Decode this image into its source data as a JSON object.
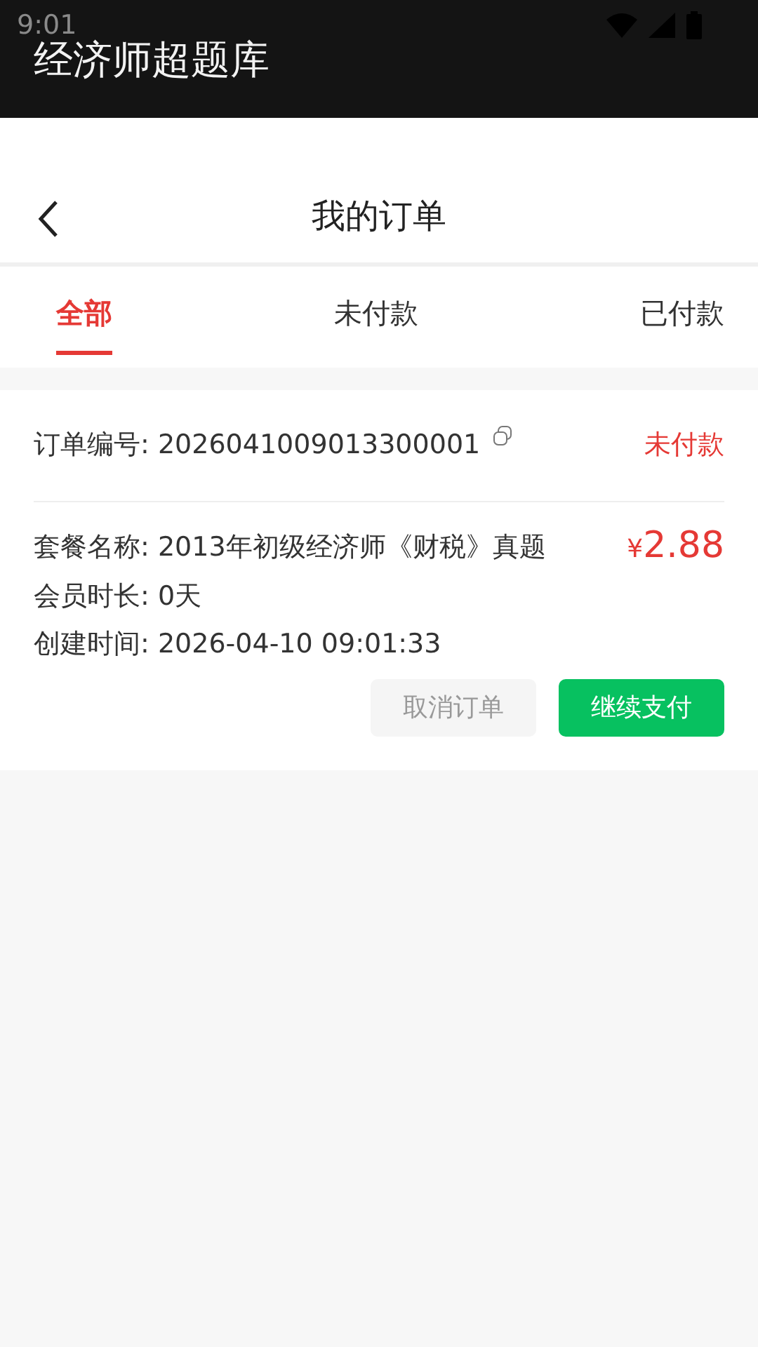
{
  "status_bar": {
    "time": "9:01"
  },
  "app_bar": {
    "title": "经济师超题库"
  },
  "header": {
    "title": "我的订单"
  },
  "tabs": [
    {
      "label": "全部",
      "selected": true
    },
    {
      "label": "未付款",
      "selected": false
    },
    {
      "label": "已付款",
      "selected": false
    }
  ],
  "orders": [
    {
      "number_label": "订单编号: 2026041009013300001",
      "status": "未付款",
      "package": "套餐名称: 2013年初级经济师《财税》真题",
      "currency": "¥",
      "price": "2.88",
      "duration": "会员时长: 0天",
      "created": "创建时间: 2026-04-10 09:01:33",
      "buttons": [
        {
          "label": "取消订单",
          "kind": "secondary"
        },
        {
          "label": "继续支付",
          "kind": "primary"
        }
      ]
    }
  ]
}
